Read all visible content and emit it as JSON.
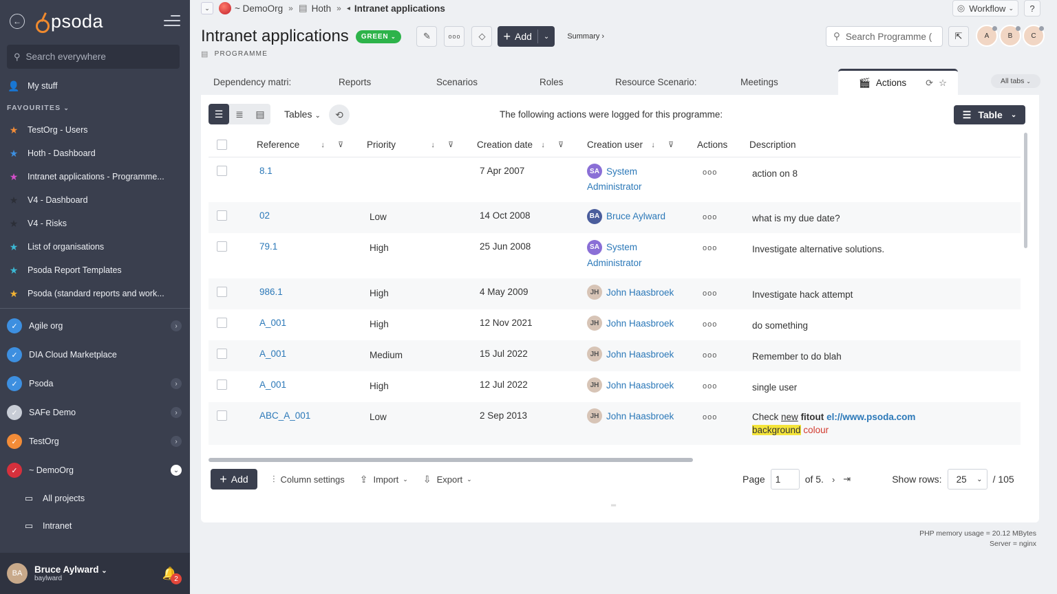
{
  "sidebar": {
    "logo": "psoda",
    "search_placeholder": "Search everywhere",
    "my_stuff": "My stuff",
    "favourites_label": "FAVOURITES",
    "favourites": [
      {
        "label": "TestOrg - Users",
        "color": "#f28c38"
      },
      {
        "label": "Hoth - Dashboard",
        "color": "#3d8fe0"
      },
      {
        "label": "Intranet applications - Programme...",
        "color": "#d44fc9"
      },
      {
        "label": "V4 - Dashboard",
        "color": "#2c2f38"
      },
      {
        "label": "V4 - Risks",
        "color": "#2c2f38"
      },
      {
        "label": "List of organisations",
        "color": "#3bb8d4"
      },
      {
        "label": "Psoda Report Templates",
        "color": "#3bb8d4"
      },
      {
        "label": "Psoda (standard reports and work...",
        "color": "#f2b233"
      }
    ],
    "orgs": [
      {
        "label": "Agile org",
        "color": "#3d8fe0",
        "expand": true
      },
      {
        "label": "DIA Cloud Marketplace",
        "color": "#3d8fe0",
        "expand": false
      },
      {
        "label": "Psoda",
        "color": "#3d8fe0",
        "expand": true
      },
      {
        "label": "SAFe Demo",
        "color": "#c8cdd6",
        "expand": true
      },
      {
        "label": "TestOrg",
        "color": "#f28c38",
        "expand": true
      },
      {
        "label": "~ DemoOrg",
        "color": "#d6303c",
        "expand": true,
        "open": true
      }
    ],
    "sub_items": [
      "All projects",
      "Intranet"
    ],
    "user": {
      "name": "Bruce Aylward",
      "login": "baylward",
      "notifications": "2"
    }
  },
  "breadcrumb": {
    "org": "~ DemoOrg",
    "parent": "Hoth",
    "current": "Intranet applications"
  },
  "header": {
    "workflow": "Workflow",
    "help": "?",
    "title": "Intranet applications",
    "status": "GREEN",
    "add": "Add",
    "summary": "Summary ›",
    "type": "PROGRAMME",
    "search_placeholder": "Search Programme (",
    "team_initials": [
      "A",
      "B",
      "C"
    ]
  },
  "tabs": {
    "items": [
      "Dependency matri:",
      "Reports",
      "Scenarios",
      "Roles",
      "Resource Scenario:",
      "Meetings"
    ],
    "active": "Actions",
    "all_tabs": "All tabs"
  },
  "panel": {
    "tables_label": "Tables",
    "message": "The following actions were logged for this programme:",
    "table_button": "Table",
    "columns": [
      "Reference",
      "Priority",
      "Creation date",
      "Creation user",
      "Actions",
      "Description"
    ],
    "rows": [
      {
        "ref": "8.1",
        "priority": "",
        "date": "7 Apr 2007",
        "user_initials": "SA",
        "user_kind": "sa",
        "user_line1": "System",
        "user_line2": "Administrator",
        "desc_plain": "action on 8"
      },
      {
        "ref": "02",
        "priority": "Low",
        "date": "14 Oct 2008",
        "user_initials": "BA",
        "user_kind": "ba",
        "user_line1": "Bruce Aylward",
        "user_line2": "",
        "desc_plain": "what is my due date?"
      },
      {
        "ref": "79.1",
        "priority": "High",
        "date": "25 Jun 2008",
        "user_initials": "SA",
        "user_kind": "sa",
        "user_line1": "System",
        "user_line2": "Administrator",
        "desc_plain": "Investigate alternative solutions."
      },
      {
        "ref": "986.1",
        "priority": "High",
        "date": "4 May 2009",
        "user_initials": "JH",
        "user_kind": "jh",
        "user_line1": "John Haasbroek",
        "user_line2": "",
        "desc_plain": "Investigate hack attempt"
      },
      {
        "ref": "A_001",
        "priority": "High",
        "date": "12 Nov 2021",
        "user_initials": "JH",
        "user_kind": "jh",
        "user_line1": "John Haasbroek",
        "user_line2": "",
        "desc_plain": "do something"
      },
      {
        "ref": "A_001",
        "priority": "Medium",
        "date": "15 Jul 2022",
        "user_initials": "JH",
        "user_kind": "jh",
        "user_line1": "John Haasbroek",
        "user_line2": "",
        "desc_plain": "Remember to do blah"
      },
      {
        "ref": "A_001",
        "priority": "High",
        "date": "12 Jul 2022",
        "user_initials": "JH",
        "user_kind": "jh",
        "user_line1": "John Haasbroek",
        "user_line2": "",
        "desc_plain": "single user"
      },
      {
        "ref": "ABC_A_001",
        "priority": "Low",
        "date": "2 Sep 2013",
        "user_initials": "JH",
        "user_kind": "jh",
        "user_line1": "John Haasbroek",
        "user_line2": "",
        "desc_rich": {
          "w1": "Check",
          "w2": "new",
          "w3": "fitout",
          "w4": "el://www.psoda.com",
          "w5": "background",
          "w6": "colour"
        }
      }
    ],
    "footer": {
      "add": "Add",
      "column_settings": "Column settings",
      "import": "Import",
      "export": "Export",
      "page_label": "Page",
      "page_value": "1",
      "page_of": "of 5.",
      "show_rows_label": "Show rows:",
      "rows_value": "25",
      "total": "/ 105"
    }
  },
  "memory": {
    "line1": "PHP memory usage = 20.12 MBytes",
    "line2": "Server = nginx"
  }
}
